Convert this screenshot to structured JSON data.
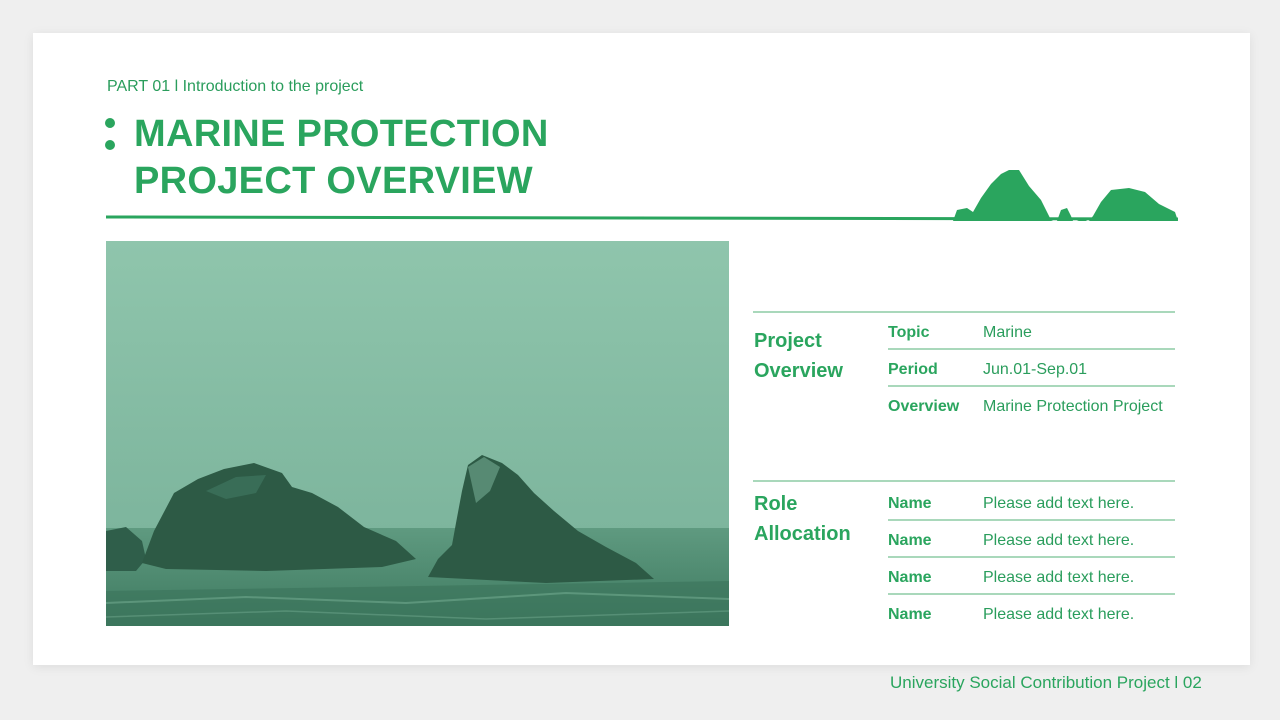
{
  "header": {
    "part_label": "PART 01 l Introduction to the project",
    "title_line1": "MARINE PROTECTION",
    "title_line2": "PROJECT OVERVIEW"
  },
  "project_overview": {
    "title_line1": "Project",
    "title_line2": "Overview",
    "rows": [
      {
        "key": "Topic",
        "value": "Marine"
      },
      {
        "key": "Period",
        "value": "Jun.01-Sep.01"
      },
      {
        "key": "Overview",
        "value": "Marine Protection Project"
      }
    ]
  },
  "role_allocation": {
    "title_line1": "Role",
    "title_line2": "Allocation",
    "rows": [
      {
        "key": "Name",
        "value": "Please add text here."
      },
      {
        "key": "Name",
        "value": "Please add text here."
      },
      {
        "key": "Name",
        "value": "Please add text here."
      },
      {
        "key": "Name",
        "value": "Please add text here."
      }
    ]
  },
  "footer": {
    "text": "University Social Contribution Project l 02"
  },
  "colors": {
    "accent": "#2aa55e",
    "rule": "#a9d8bb",
    "photo_tint": "#8fc5ac"
  },
  "icons": {
    "title_marker": "two-dots-icon",
    "rocks_silhouette": "rock-islands-icon"
  }
}
